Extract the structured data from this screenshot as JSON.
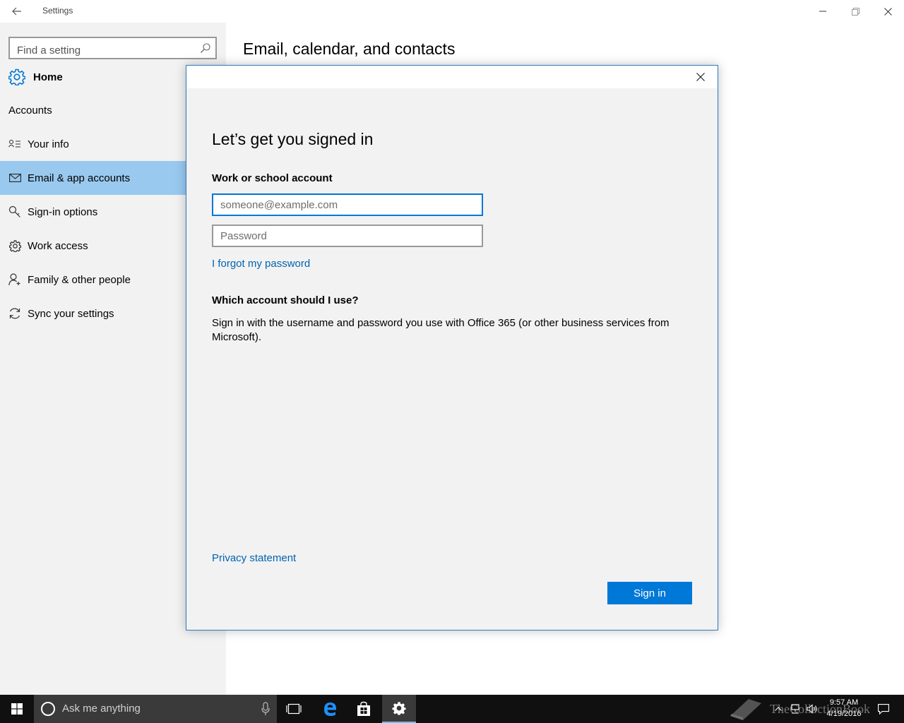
{
  "window": {
    "title": "Settings"
  },
  "sidebar": {
    "search_placeholder": "Find a setting",
    "home_label": "Home",
    "section_title": "Accounts",
    "items": [
      {
        "label": "Your info",
        "icon": "contact-card-icon"
      },
      {
        "label": "Email & app accounts",
        "icon": "mail-icon",
        "selected": true
      },
      {
        "label": "Sign-in options",
        "icon": "key-icon"
      },
      {
        "label": "Work access",
        "icon": "gear-icon"
      },
      {
        "label": "Family & other people",
        "icon": "person-add-icon"
      },
      {
        "label": "Sync your settings",
        "icon": "sync-icon"
      }
    ]
  },
  "main": {
    "title": "Email, calendar, and contacts"
  },
  "dialog": {
    "heading": "Let’s get you signed in",
    "account_label": "Work or school account",
    "email_placeholder": "someone@example.com",
    "email_value": "",
    "password_placeholder": "Password",
    "password_value": "",
    "forgot_link": "I forgot my password",
    "question_title": "Which account should I use?",
    "question_text": "Sign in with the username and password you use with Office 365 (or other business services from Microsoft).",
    "privacy_link": "Privacy statement",
    "signin_button": "Sign in"
  },
  "taskbar": {
    "search_placeholder": "Ask me anything",
    "time": "9:57 AM",
    "date": "4/19/2016",
    "watermark": "TheCollectionBook"
  },
  "colors": {
    "accent": "#0078d7",
    "selected_nav": "#99c9ef",
    "link": "#0063b1",
    "sidebar_bg": "#f2f2f2"
  }
}
